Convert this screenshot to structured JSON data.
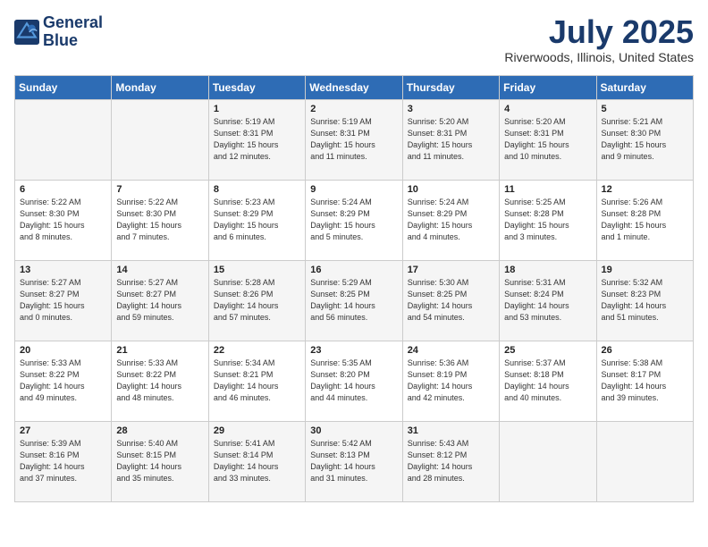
{
  "header": {
    "logo_line1": "General",
    "logo_line2": "Blue",
    "month_year": "July 2025",
    "location": "Riverwoods, Illinois, United States"
  },
  "days_of_week": [
    "Sunday",
    "Monday",
    "Tuesday",
    "Wednesday",
    "Thursday",
    "Friday",
    "Saturday"
  ],
  "weeks": [
    [
      {
        "day": "",
        "detail": ""
      },
      {
        "day": "",
        "detail": ""
      },
      {
        "day": "1",
        "detail": "Sunrise: 5:19 AM\nSunset: 8:31 PM\nDaylight: 15 hours\nand 12 minutes."
      },
      {
        "day": "2",
        "detail": "Sunrise: 5:19 AM\nSunset: 8:31 PM\nDaylight: 15 hours\nand 11 minutes."
      },
      {
        "day": "3",
        "detail": "Sunrise: 5:20 AM\nSunset: 8:31 PM\nDaylight: 15 hours\nand 11 minutes."
      },
      {
        "day": "4",
        "detail": "Sunrise: 5:20 AM\nSunset: 8:31 PM\nDaylight: 15 hours\nand 10 minutes."
      },
      {
        "day": "5",
        "detail": "Sunrise: 5:21 AM\nSunset: 8:30 PM\nDaylight: 15 hours\nand 9 minutes."
      }
    ],
    [
      {
        "day": "6",
        "detail": "Sunrise: 5:22 AM\nSunset: 8:30 PM\nDaylight: 15 hours\nand 8 minutes."
      },
      {
        "day": "7",
        "detail": "Sunrise: 5:22 AM\nSunset: 8:30 PM\nDaylight: 15 hours\nand 7 minutes."
      },
      {
        "day": "8",
        "detail": "Sunrise: 5:23 AM\nSunset: 8:29 PM\nDaylight: 15 hours\nand 6 minutes."
      },
      {
        "day": "9",
        "detail": "Sunrise: 5:24 AM\nSunset: 8:29 PM\nDaylight: 15 hours\nand 5 minutes."
      },
      {
        "day": "10",
        "detail": "Sunrise: 5:24 AM\nSunset: 8:29 PM\nDaylight: 15 hours\nand 4 minutes."
      },
      {
        "day": "11",
        "detail": "Sunrise: 5:25 AM\nSunset: 8:28 PM\nDaylight: 15 hours\nand 3 minutes."
      },
      {
        "day": "12",
        "detail": "Sunrise: 5:26 AM\nSunset: 8:28 PM\nDaylight: 15 hours\nand 1 minute."
      }
    ],
    [
      {
        "day": "13",
        "detail": "Sunrise: 5:27 AM\nSunset: 8:27 PM\nDaylight: 15 hours\nand 0 minutes."
      },
      {
        "day": "14",
        "detail": "Sunrise: 5:27 AM\nSunset: 8:27 PM\nDaylight: 14 hours\nand 59 minutes."
      },
      {
        "day": "15",
        "detail": "Sunrise: 5:28 AM\nSunset: 8:26 PM\nDaylight: 14 hours\nand 57 minutes."
      },
      {
        "day": "16",
        "detail": "Sunrise: 5:29 AM\nSunset: 8:25 PM\nDaylight: 14 hours\nand 56 minutes."
      },
      {
        "day": "17",
        "detail": "Sunrise: 5:30 AM\nSunset: 8:25 PM\nDaylight: 14 hours\nand 54 minutes."
      },
      {
        "day": "18",
        "detail": "Sunrise: 5:31 AM\nSunset: 8:24 PM\nDaylight: 14 hours\nand 53 minutes."
      },
      {
        "day": "19",
        "detail": "Sunrise: 5:32 AM\nSunset: 8:23 PM\nDaylight: 14 hours\nand 51 minutes."
      }
    ],
    [
      {
        "day": "20",
        "detail": "Sunrise: 5:33 AM\nSunset: 8:22 PM\nDaylight: 14 hours\nand 49 minutes."
      },
      {
        "day": "21",
        "detail": "Sunrise: 5:33 AM\nSunset: 8:22 PM\nDaylight: 14 hours\nand 48 minutes."
      },
      {
        "day": "22",
        "detail": "Sunrise: 5:34 AM\nSunset: 8:21 PM\nDaylight: 14 hours\nand 46 minutes."
      },
      {
        "day": "23",
        "detail": "Sunrise: 5:35 AM\nSunset: 8:20 PM\nDaylight: 14 hours\nand 44 minutes."
      },
      {
        "day": "24",
        "detail": "Sunrise: 5:36 AM\nSunset: 8:19 PM\nDaylight: 14 hours\nand 42 minutes."
      },
      {
        "day": "25",
        "detail": "Sunrise: 5:37 AM\nSunset: 8:18 PM\nDaylight: 14 hours\nand 40 minutes."
      },
      {
        "day": "26",
        "detail": "Sunrise: 5:38 AM\nSunset: 8:17 PM\nDaylight: 14 hours\nand 39 minutes."
      }
    ],
    [
      {
        "day": "27",
        "detail": "Sunrise: 5:39 AM\nSunset: 8:16 PM\nDaylight: 14 hours\nand 37 minutes."
      },
      {
        "day": "28",
        "detail": "Sunrise: 5:40 AM\nSunset: 8:15 PM\nDaylight: 14 hours\nand 35 minutes."
      },
      {
        "day": "29",
        "detail": "Sunrise: 5:41 AM\nSunset: 8:14 PM\nDaylight: 14 hours\nand 33 minutes."
      },
      {
        "day": "30",
        "detail": "Sunrise: 5:42 AM\nSunset: 8:13 PM\nDaylight: 14 hours\nand 31 minutes."
      },
      {
        "day": "31",
        "detail": "Sunrise: 5:43 AM\nSunset: 8:12 PM\nDaylight: 14 hours\nand 28 minutes."
      },
      {
        "day": "",
        "detail": ""
      },
      {
        "day": "",
        "detail": ""
      }
    ]
  ]
}
